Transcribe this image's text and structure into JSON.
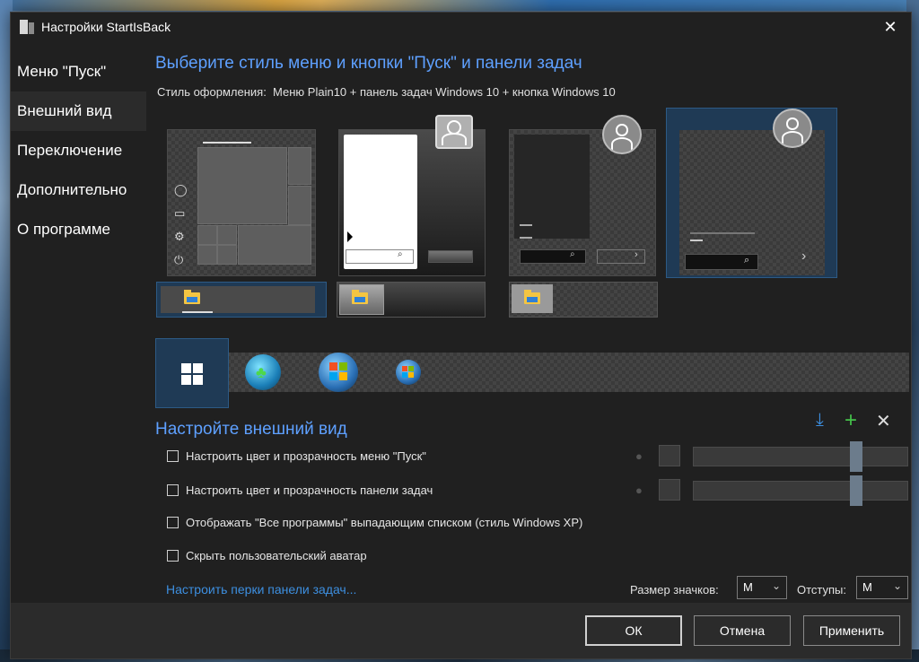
{
  "window": {
    "title": "Настройки StartIsBack",
    "close_glyph": "✕"
  },
  "sidebar": {
    "items": [
      {
        "label": "Меню \"Пуск\"",
        "active": false
      },
      {
        "label": "Внешний вид",
        "active": true
      },
      {
        "label": "Переключение",
        "active": false
      },
      {
        "label": "Дополнительно",
        "active": false
      },
      {
        "label": "О программе",
        "active": false
      }
    ]
  },
  "main": {
    "heading1": "Выберите стиль меню и кнопки \"Пуск\" и панели задач",
    "style_label": "Стиль оформления:",
    "style_value": "Меню Plain10 + панель задач Windows 10 + кнопка Windows 10",
    "heading2": "Настройте внешний вид"
  },
  "options": [
    {
      "label": "Настроить цвет и прозрачность меню \"Пуск\"",
      "checked": false,
      "has_slider": true,
      "slider_value": 0.78
    },
    {
      "label": "Настроить цвет и прозрачность панели задач",
      "checked": false,
      "has_slider": true,
      "slider_value": 0.78
    },
    {
      "label": "Отображать \"Все программы\" выпадающим списком (стиль Windows XP)",
      "checked": false
    },
    {
      "label": "Скрыть пользовательский аватар",
      "checked": false
    }
  ],
  "taskbar_link": "Настроить перки панели задач...",
  "icon_size": {
    "label": "Размер значков:",
    "value": "M"
  },
  "padding": {
    "label": "Отступы:",
    "value": "M"
  },
  "buttons": {
    "ok": "ОК",
    "cancel": "Отмена",
    "apply": "Применить"
  },
  "toolbar_icons": [
    "download-icon",
    "add-icon",
    "close-icon"
  ],
  "colors": {
    "accent": "#5ea0ff",
    "link": "#3d8fe0",
    "selected": "#1f3a55",
    "window_bg": "#202020"
  }
}
